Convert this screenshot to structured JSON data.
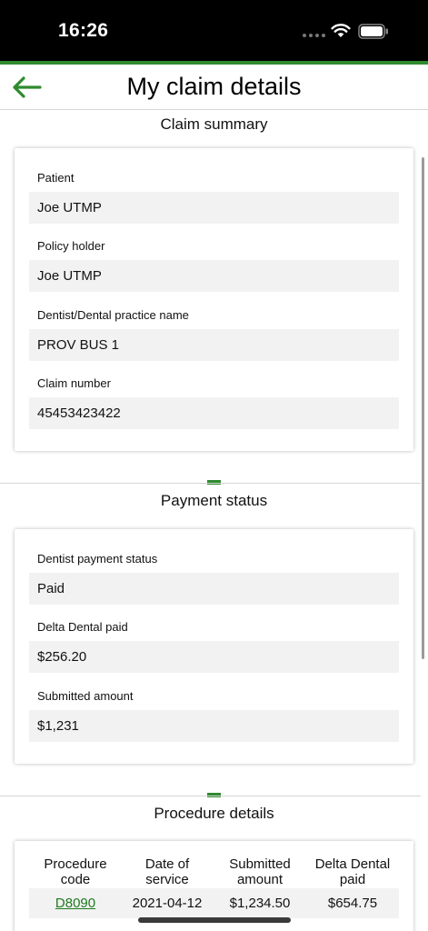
{
  "status_bar": {
    "time": "16:26"
  },
  "header": {
    "title": "My claim details",
    "back_icon": "arrow-left-icon",
    "accent_color": "#2e8b2e"
  },
  "claim_summary": {
    "title": "Claim summary",
    "fields": [
      {
        "label": "Patient",
        "value": "Joe UTMP"
      },
      {
        "label": "Policy holder",
        "value": "Joe UTMP"
      },
      {
        "label": "Dentist/Dental practice name",
        "value": "PROV BUS 1"
      },
      {
        "label": "Claim number",
        "value": "45453423422"
      }
    ]
  },
  "payment_status": {
    "title": "Payment status",
    "fields": [
      {
        "label": "Dentist payment status",
        "value": "Paid"
      },
      {
        "label": "Delta Dental paid",
        "value": "$256.20"
      },
      {
        "label": "Submitted amount",
        "value": "$1,231"
      }
    ]
  },
  "procedure_details": {
    "title": "Procedure details",
    "columns": [
      {
        "line1": "Procedure",
        "line2": "code"
      },
      {
        "line1": "Date of",
        "line2": "service"
      },
      {
        "line1": "Submitted",
        "line2": "amount"
      },
      {
        "line1": "Delta Dental",
        "line2": "paid"
      }
    ],
    "rows": [
      {
        "code": "D8090",
        "date": "2021-04-12",
        "submitted": "$1,234.50",
        "paid": "$654.75"
      }
    ]
  }
}
